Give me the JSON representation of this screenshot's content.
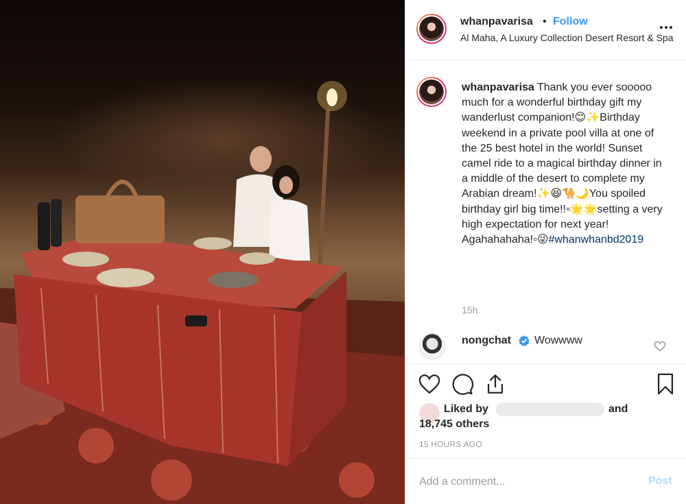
{
  "post": {
    "username": "whanpavarisa",
    "separator": "•",
    "follow_label": "Follow",
    "location": "Al Maha, A Luxury Collection Desert Resort & Spa",
    "more_icon": "more-horizontal-icon"
  },
  "caption": {
    "username": "whanpavarisa",
    "text_1": " Thank you ever sooooo much for a wonderful birthday gift my wanderlust companion!😊✨Birthday weekend in a private pool villa at one of the 25 best hotel in the world! Sunset camel ride to a magical birthday dinner in a middle of the desert to complete my Arabian dream!✨😆🐪🌙You spoiled birthday girl big time!!▫🌟🌟setting a very high expectation for next year! Agahahahaha!▫😜",
    "hashtag": "#whanwhanbd2019",
    "time": "15h"
  },
  "comment": {
    "username": "nongchat",
    "text": "Wowwww",
    "verified_icon": "verified-badge-icon",
    "like_icon": "heart-outline-icon"
  },
  "actions": {
    "like_icon": "heart-outline-icon",
    "comment_icon": "comment-bubble-icon",
    "share_icon": "share-icon",
    "save_icon": "bookmark-icon"
  },
  "likes": {
    "prefix": "Liked by",
    "and": "and",
    "others": "18,745 others"
  },
  "timestamp": "15 HOURS AGO",
  "comment_box": {
    "placeholder": "Add a comment...",
    "post_label": "Post"
  },
  "colors": {
    "follow": "#3897f0",
    "hashtag": "#003569",
    "post_disabled": "#b3dbff",
    "verified": "#3897f0"
  }
}
